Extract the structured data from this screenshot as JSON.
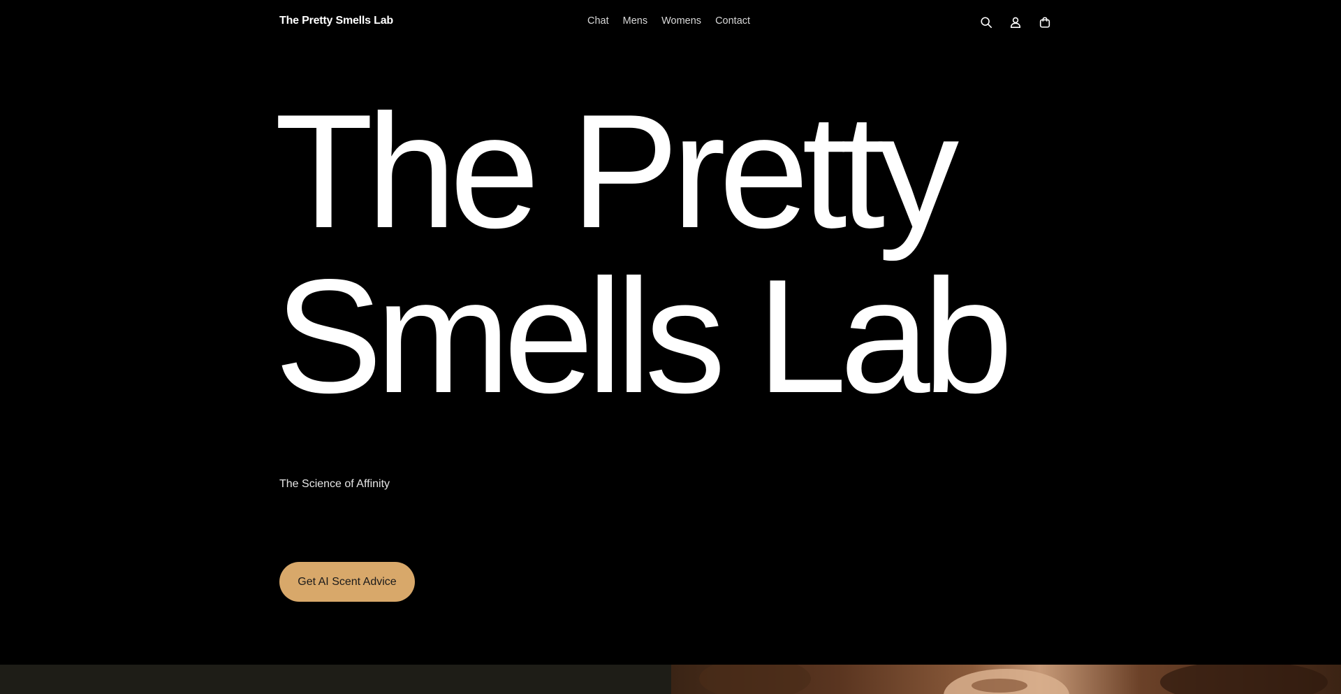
{
  "header": {
    "brand": "The Pretty Smells Lab",
    "nav": [
      "Chat",
      "Mens",
      "Womens",
      "Contact"
    ],
    "icons": [
      "search-icon",
      "account-icon",
      "cart-icon"
    ]
  },
  "hero": {
    "title_line1": "The Pretty",
    "title_line2": "Smells Lab",
    "subtitle": "The Science of Affinity",
    "cta_label": "Get AI Scent Advice"
  },
  "colors": {
    "background": "#000000",
    "cta": "#d8a86a",
    "footer_band": "#1e1d17"
  }
}
